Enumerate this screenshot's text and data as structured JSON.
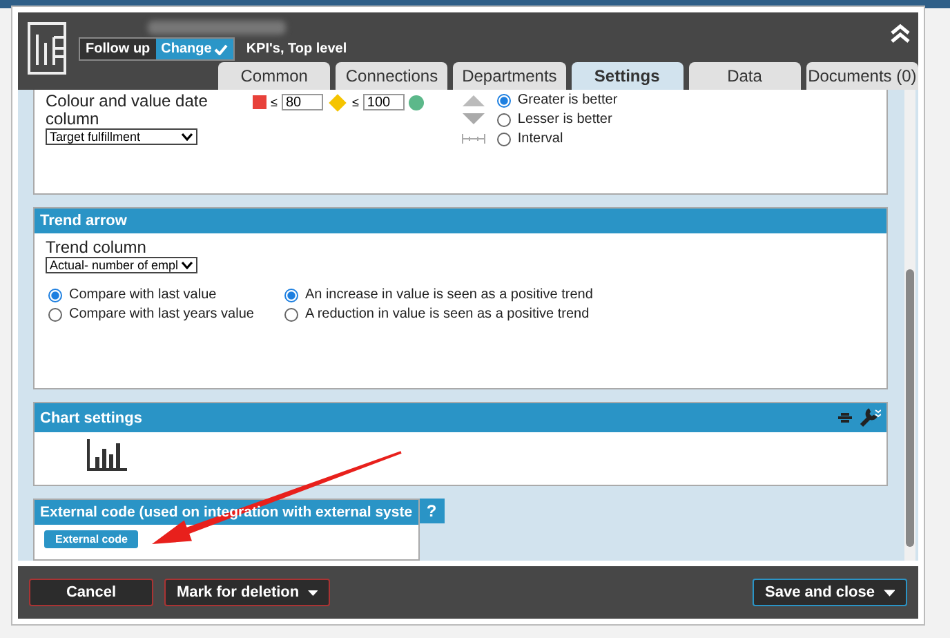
{
  "dialog": {
    "subtitle": "KPI's, Top level",
    "mode_toggle": [
      {
        "label": "Follow up",
        "selected": false
      },
      {
        "label": "Change",
        "selected": true
      }
    ],
    "tabs": [
      {
        "label": "Common",
        "selected": false
      },
      {
        "label": "Connections",
        "selected": false
      },
      {
        "label": "Departments",
        "selected": false
      },
      {
        "label": "Settings",
        "selected": true
      },
      {
        "label": "Data",
        "selected": false
      },
      {
        "label": "Documents (0)",
        "selected": false
      }
    ],
    "colour_section": {
      "label": "Colour and value date column",
      "select": "Target fulfillment",
      "thresholds": [
        {
          "kind": "square",
          "color": "#e8413a",
          "operator": "≤",
          "value": "80"
        },
        {
          "kind": "diamond",
          "color": "#f5c400",
          "operator": "≤",
          "value": "100"
        },
        {
          "kind": "circle",
          "color": "#5cb88a"
        }
      ],
      "direction": [
        {
          "kind": "up",
          "label": "Greater is better",
          "selected": true
        },
        {
          "kind": "down",
          "label": "Lesser is better",
          "selected": false
        },
        {
          "kind": "interval",
          "label": "Interval",
          "selected": false
        }
      ]
    },
    "trend_section": {
      "title": "Trend arrow",
      "label": "Trend column",
      "select": "Actual- number of empl",
      "compare": [
        {
          "label": "Compare with last value",
          "selected": true
        },
        {
          "label": "Compare with last years value",
          "selected": false
        }
      ],
      "direction": [
        {
          "label": "An increase in value is seen as a positive trend",
          "selected": true
        },
        {
          "label": "A reduction in value is seen as a positive trend",
          "selected": false
        }
      ]
    },
    "chart_section": {
      "title": "Chart settings"
    },
    "external_section": {
      "title": "External code (used on integration with external syste",
      "help": "?",
      "button": "External code"
    },
    "footer": {
      "cancel": "Cancel",
      "delete": "Mark for deletion",
      "save": "Save and close"
    }
  }
}
